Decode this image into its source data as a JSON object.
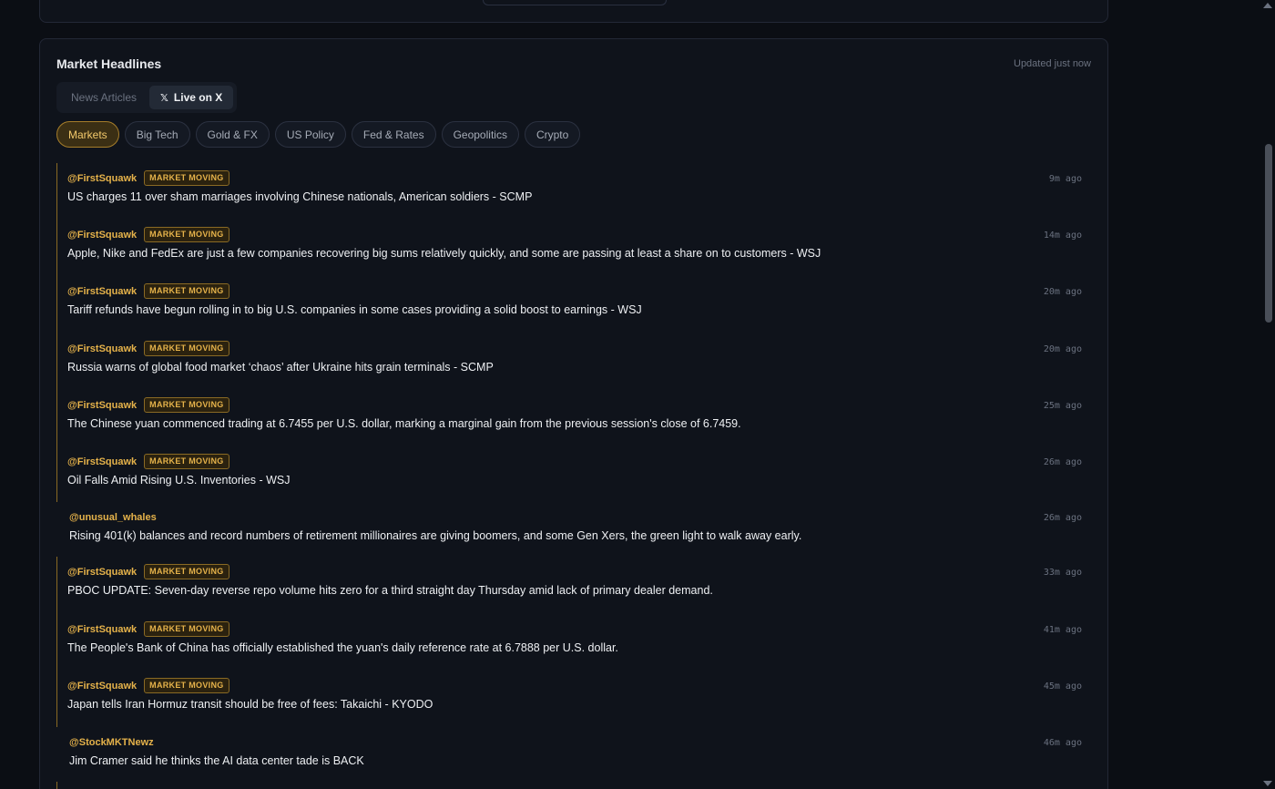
{
  "card": {
    "title": "Market Headlines",
    "updated": "Updated just now"
  },
  "tabs": [
    {
      "label": "News Articles",
      "active": false
    },
    {
      "label": "Live on X",
      "icon": "x-logo-icon",
      "icon_glyph": "𝕏",
      "active": true
    }
  ],
  "filters": [
    {
      "label": "Markets",
      "active": true
    },
    {
      "label": "Big Tech",
      "active": false
    },
    {
      "label": "Gold & FX",
      "active": false
    },
    {
      "label": "US Policy",
      "active": false
    },
    {
      "label": "Fed & Rates",
      "active": false
    },
    {
      "label": "Geopolitics",
      "active": false
    },
    {
      "label": "Crypto",
      "active": false
    }
  ],
  "badge_label": "MARKET MOVING",
  "feed": [
    {
      "handle": "@FirstSquawk",
      "market_moving": true,
      "text": "US charges 11 over sham marriages involving Chinese nationals, American soldiers - SCMP",
      "time": "9m ago"
    },
    {
      "handle": "@FirstSquawk",
      "market_moving": true,
      "text": "Apple, Nike and FedEx are just a few companies recovering big sums relatively quickly, and some are passing at least a share on to customers - WSJ",
      "time": "14m ago"
    },
    {
      "handle": "@FirstSquawk",
      "market_moving": true,
      "text": "Tariff refunds have begun rolling in to big U.S. companies in some cases providing a solid boost to earnings - WSJ",
      "time": "20m ago"
    },
    {
      "handle": "@FirstSquawk",
      "market_moving": true,
      "text": "Russia warns of global food market ‘chaos’ after Ukraine hits grain terminals - SCMP",
      "time": "20m ago"
    },
    {
      "handle": "@FirstSquawk",
      "market_moving": true,
      "text": "The Chinese yuan commenced trading at 6.7455 per U.S. dollar, marking a marginal gain from the previous session's close of 6.7459.",
      "time": "25m ago"
    },
    {
      "handle": "@FirstSquawk",
      "market_moving": true,
      "text": "Oil Falls Amid Rising U.S. Inventories - WSJ",
      "time": "26m ago"
    },
    {
      "handle": "@unusual_whales",
      "market_moving": false,
      "text": "Rising 401(k) balances and record numbers of retirement millionaires are giving boomers, and some Gen Xers, the green light to walk away early.",
      "time": "26m ago"
    },
    {
      "handle": "@FirstSquawk",
      "market_moving": true,
      "text": "PBOC UPDATE: Seven-day reverse repo volume hits zero for a third straight day Thursday amid lack of primary dealer demand.",
      "time": "33m ago"
    },
    {
      "handle": "@FirstSquawk",
      "market_moving": true,
      "text": "The People's Bank of China has officially established the yuan's daily reference rate at 6.7888 per U.S. dollar.",
      "time": "41m ago"
    },
    {
      "handle": "@FirstSquawk",
      "market_moving": true,
      "text": "Japan tells Iran Hormuz transit should be free of fees: Takaichi - KYODO",
      "time": "45m ago"
    },
    {
      "handle": "@StockMKTNewz",
      "market_moving": false,
      "text": "Jim Cramer said he thinks the AI data center tade is BACK",
      "time": "46m ago"
    },
    {
      "handle": "",
      "market_moving": true,
      "text": "",
      "time": ""
    }
  ],
  "colors": {
    "accent": "#e5b24a",
    "background": "#0b0e14",
    "card": "#0f131b"
  }
}
